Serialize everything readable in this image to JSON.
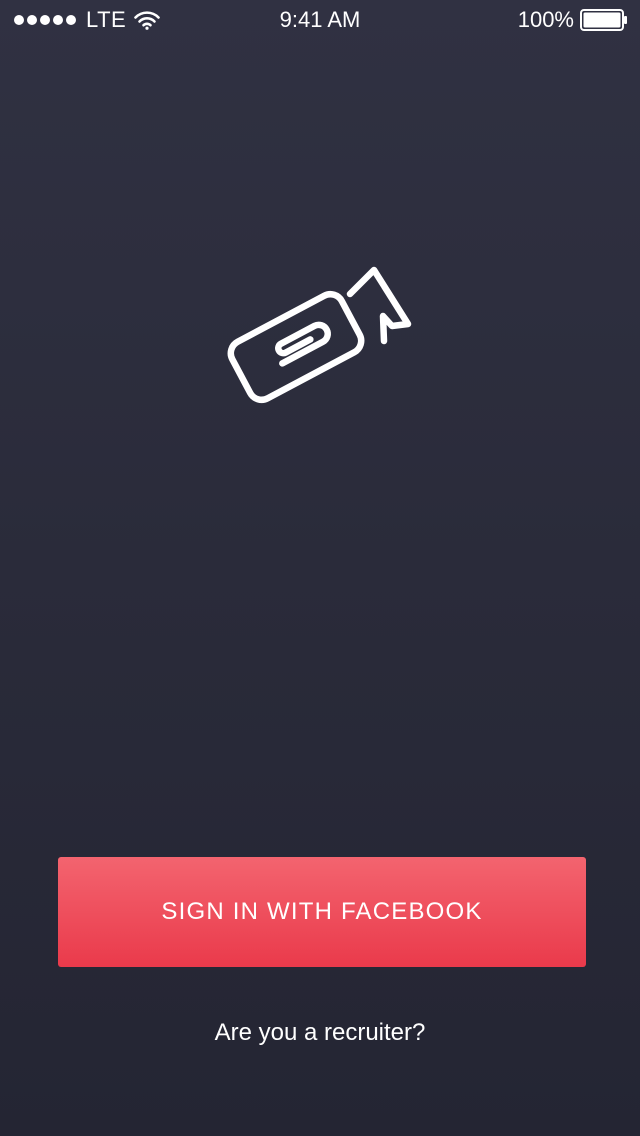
{
  "status_bar": {
    "carrier": "LTE",
    "time": "9:41 AM",
    "battery_percent": "100%",
    "signal_bars": 5,
    "battery_level": 1.0,
    "icons": [
      "signal-dots-icon",
      "wifi-icon",
      "battery-icon"
    ]
  },
  "logo": {
    "icon": "camera-paperclip-logo-icon"
  },
  "actions": {
    "facebook_button_label": "SIGN IN WITH FACEBOOK",
    "recruiter_link_label": "Are you a recruiter?"
  },
  "colors": {
    "background_top": "#303142",
    "background_bottom": "#242533",
    "button_top": "#f3646f",
    "button_bottom": "#ea3a4b",
    "text": "#ffffff"
  }
}
